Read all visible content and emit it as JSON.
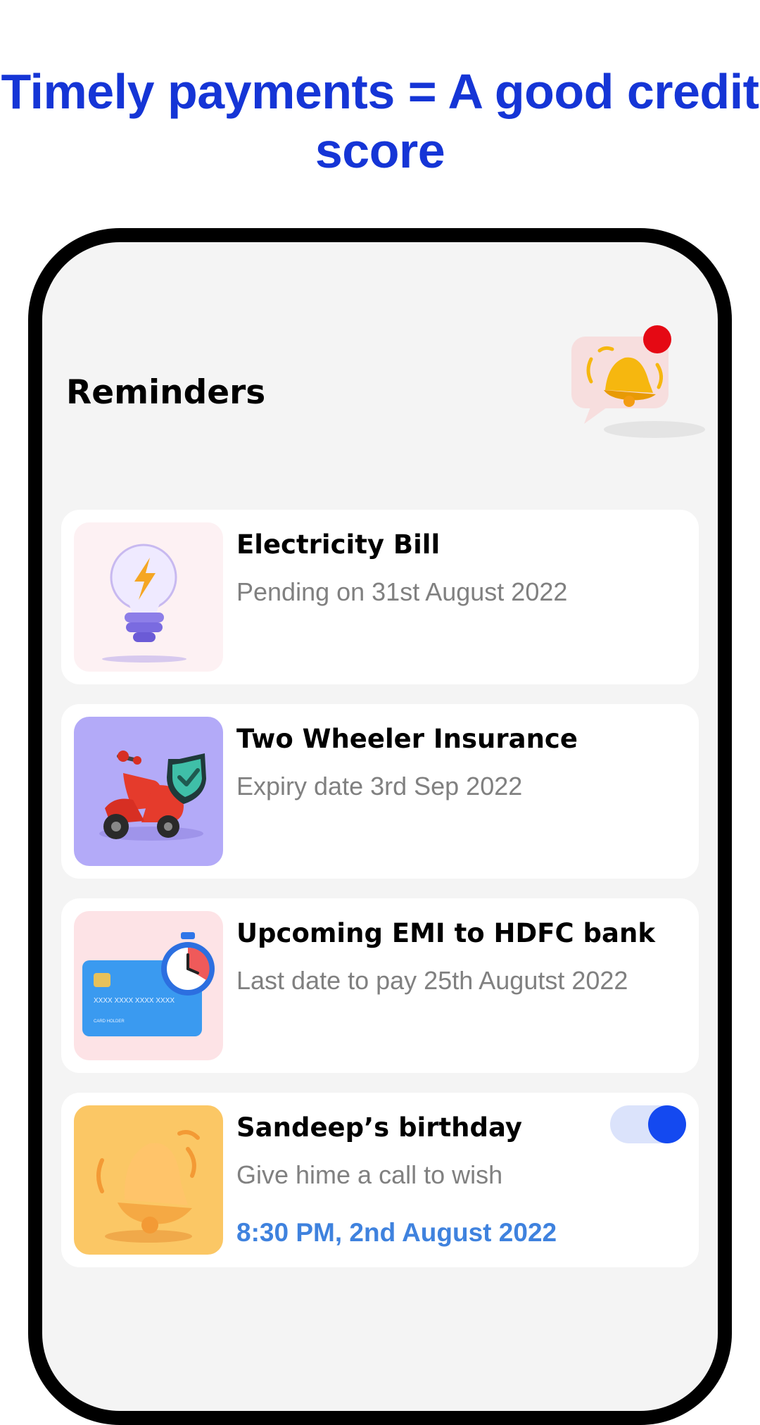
{
  "headline": "Timely payments = A good credit score",
  "screen": {
    "title": "Reminders"
  },
  "reminders": [
    {
      "title": "Electricity Bill",
      "subtitle": "Pending on 31st August 2022",
      "icon": "lightbulb-icon"
    },
    {
      "title": "Two Wheeler Insurance",
      "subtitle": "Expiry date 3rd Sep 2022",
      "icon": "scooter-shield-icon"
    },
    {
      "title": "Upcoming EMI to HDFC bank",
      "subtitle": "Last date to pay 25th Augutst 2022",
      "icon": "credit-card-stopwatch-icon",
      "card_text": {
        "number": "XXXX   XXXX   XXXX   XXXX",
        "holder": "CARD HOLDER"
      }
    },
    {
      "title": "Sandeep’s birthday",
      "subtitle": "Give hime a call to wish",
      "time": "8:30 PM, 2nd August 2022",
      "icon": "bell-icon",
      "toggle_on": true
    }
  ],
  "colors": {
    "headline": "#1535d6",
    "accent_time": "#3f82de",
    "toggle": "#1449f0",
    "notification_dot": "#e50914"
  }
}
